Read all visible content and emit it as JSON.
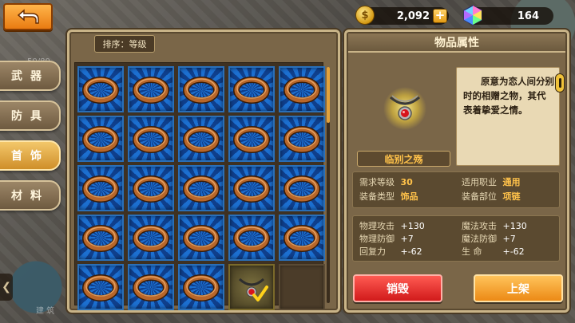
{
  "currency": {
    "gold": "2,092",
    "gold_plus": "+",
    "gems": "164",
    "gold_icon_glyph": "$"
  },
  "tabs": [
    {
      "label": "武器",
      "active": false
    },
    {
      "label": "防具",
      "active": false
    },
    {
      "label": "首饰",
      "active": true
    },
    {
      "label": "材料",
      "active": false
    }
  ],
  "inventory": {
    "sort_label": "排序：等级",
    "slots": [
      "ring",
      "ring",
      "ring",
      "ring",
      "ring",
      "ring",
      "ring",
      "ring",
      "ring",
      "ring",
      "ring",
      "ring",
      "ring",
      "ring",
      "ring",
      "ring",
      "ring",
      "ring",
      "ring",
      "ring",
      "ring",
      "ring",
      "ring",
      "necklace-selected",
      "empty"
    ]
  },
  "item": {
    "panel_title": "物品属性",
    "name": "临别之殇",
    "description": "原意为恋人间分别时的相赠之物，其代表着挚爱之情。",
    "details": {
      "req_level_label": "需求等级",
      "req_level": "30",
      "job_label": "适用职业",
      "job": "通用",
      "type_label": "装备类型",
      "type": "饰品",
      "slot_label": "装备部位",
      "slot": "项链"
    },
    "stats": [
      {
        "label": "物理攻击",
        "value": "+130"
      },
      {
        "label": "魔法攻击",
        "value": "+130"
      },
      {
        "label": "物理防御",
        "value": "+7"
      },
      {
        "label": "魔法防御",
        "value": "+7"
      },
      {
        "label": "回复力",
        "value": "+-62"
      },
      {
        "label": "生  命",
        "value": "+-62"
      }
    ]
  },
  "actions": {
    "destroy": "销毁",
    "shelve": "上架"
  },
  "background_text": {
    "level_hint": "50/80",
    "building": "建 筑"
  },
  "colors": {
    "accent_orange": "#ec8a16",
    "destroy_red": "#d11b1b",
    "slot_blue": "#1c6fd0",
    "item_name_gold": "#ffc24a"
  }
}
